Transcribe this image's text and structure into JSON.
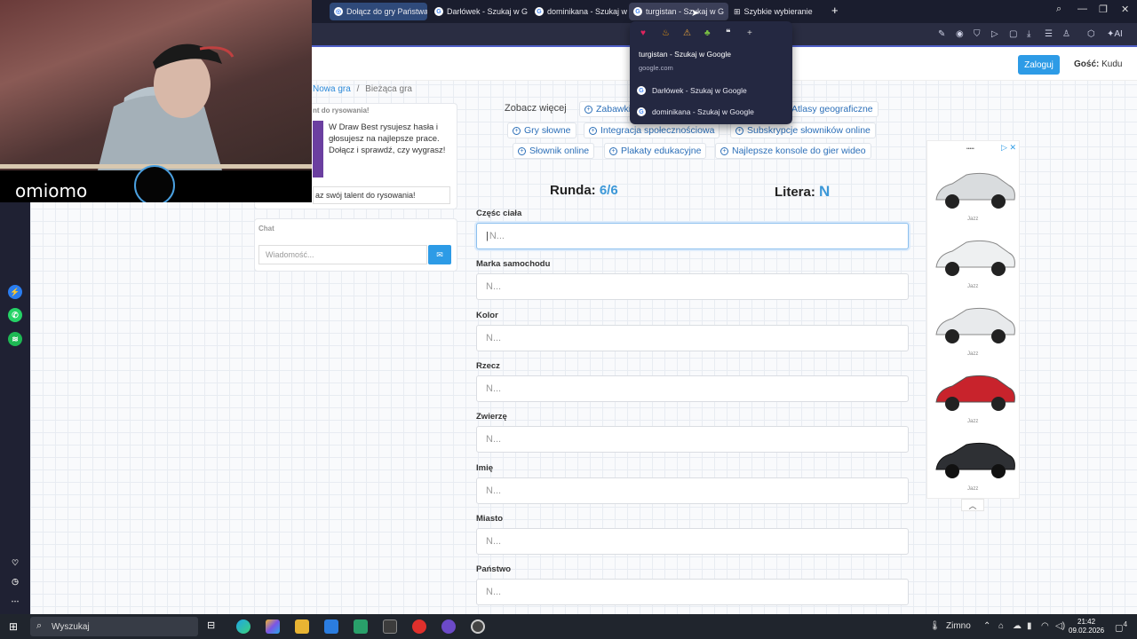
{
  "browser": {
    "tabs": [
      {
        "label": "Dołącz do gry Państwa M",
        "state": "normal"
      },
      {
        "label": "Darłówek - Szukaj w Goo",
        "state": "normal"
      },
      {
        "label": "dominikana - Szukaj w Go",
        "state": "normal"
      },
      {
        "label": "turgistan - Szukaj w G",
        "state": "active"
      },
      {
        "label": "Szybkie wybieranie",
        "state": "normal"
      }
    ],
    "new_tab": "+"
  },
  "tab_dropdown": {
    "title": "turgistan - Szukaj w Google",
    "url": "google.com",
    "items": [
      "Darłówek - Szukaj w Google",
      "dominikana - Szukaj w Google"
    ],
    "plus": "+"
  },
  "header": {
    "login_label": "Zaloguj",
    "guest_prefix": "Gość:",
    "guest_name": "Kudu"
  },
  "breadcrumb": {
    "link": "Nowa gra",
    "separator": "/",
    "current": "Bieżąca gra"
  },
  "promo": {
    "title": "nt do rysowania!",
    "text": "W Draw Best rysujesz hasła i głosujesz na najlepsze prace. Dołącz i sprawdź, czy wygrasz!",
    "button": "az swój talent do rysowania!"
  },
  "chat": {
    "title": "Chat",
    "placeholder": "Wiadomość..."
  },
  "tags": {
    "label": "Zobacz więcej",
    "items": [
      "Zabawki",
      "Atlasy geograficzne",
      "Gry słowne",
      "Integracja społecznościowa",
      "Subskrypcje słowników online",
      "Słownik online",
      "Plakaty edukacyjne",
      "Najlepsze konsole do gier wideo"
    ]
  },
  "game": {
    "round_label": "Runda:",
    "round_value": "6/6",
    "letter_label": "Litera:",
    "letter_value": "N",
    "fields": [
      {
        "label": "Częśc ciała",
        "placeholder": "N..."
      },
      {
        "label": "Marka samochodu",
        "placeholder": "N..."
      },
      {
        "label": "Kolor",
        "placeholder": "N..."
      },
      {
        "label": "Rzecz",
        "placeholder": "N..."
      },
      {
        "label": "Zwierzę",
        "placeholder": "N..."
      },
      {
        "label": "Imię",
        "placeholder": "N..."
      },
      {
        "label": "Miasto",
        "placeholder": "N..."
      },
      {
        "label": "Państwo",
        "placeholder": "N..."
      }
    ]
  },
  "ad": {
    "brand": "•••••",
    "caption": "Jazz",
    "colors": [
      "#d9dcde",
      "#eef0f1",
      "#e8eaec",
      "#c8232c",
      "#2e3034"
    ]
  },
  "webcam": {
    "name": "omiomo"
  },
  "taskbar": {
    "search": "Wyszukaj",
    "weather": "Zimno",
    "time": "21:42",
    "date": "09.02.2026",
    "notif": "4"
  }
}
